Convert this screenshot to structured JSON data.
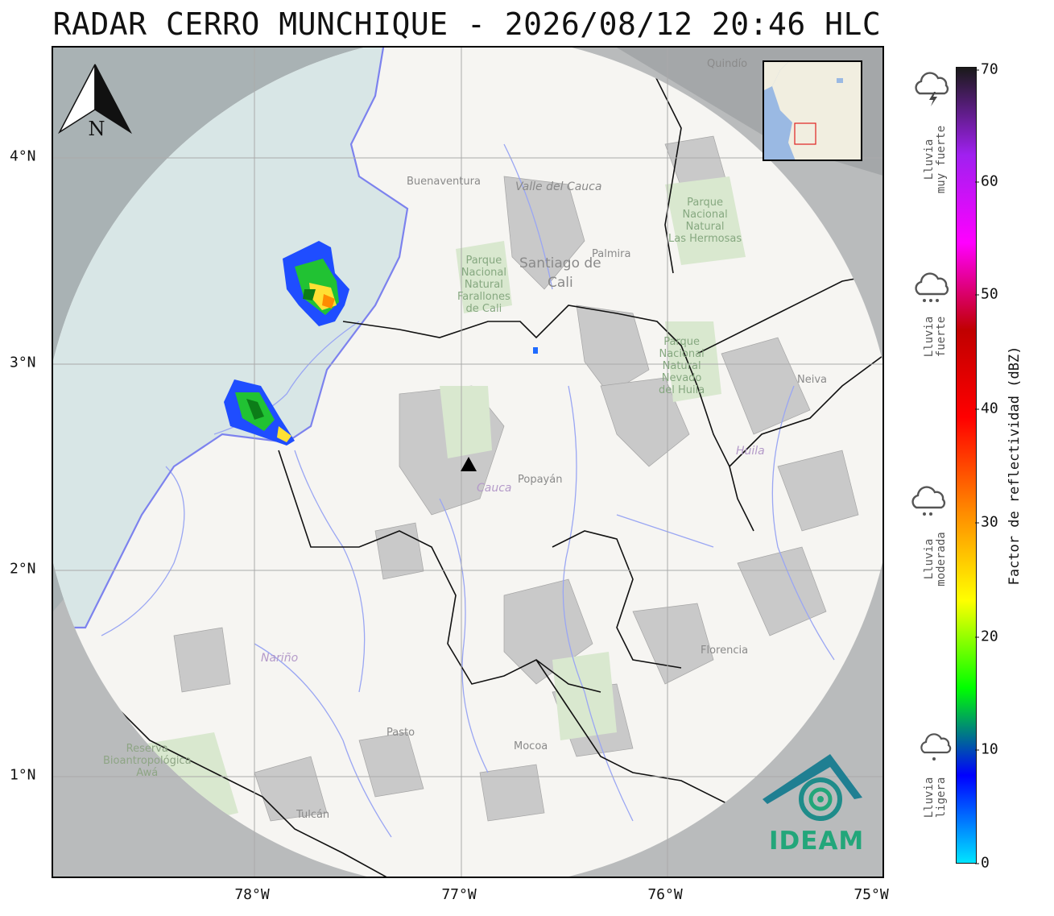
{
  "title": "RADAR CERRO MUNCHIQUE - 2026/08/12 20:46 HLC",
  "axes": {
    "x_ticks": [
      "78°W",
      "77°W",
      "76°W",
      "75°W"
    ],
    "y_ticks": [
      "4°N",
      "3°N",
      "2°N",
      "1°N"
    ]
  },
  "north_arrow": {
    "letter": "N",
    "icon": "north-arrow-icon"
  },
  "colorbar": {
    "label": "Factor de reflectividad (dBZ)",
    "ticks": [
      "70",
      "60",
      "50",
      "40",
      "30",
      "20",
      "10",
      "0"
    ],
    "range": [
      0,
      70
    ],
    "colors": [
      "#00e5ff",
      "#0000ff",
      "#00ff00",
      "#ffff00",
      "#ff8c00",
      "#ff0000",
      "#c00000",
      "#ff00ff",
      "#a020f0",
      "#1a1a1a"
    ]
  },
  "categories": [
    {
      "line1": "Lluvia",
      "line2": "muy fuerte",
      "icon": "thunderstorm-icon"
    },
    {
      "line1": "Lluvia",
      "line2": "fuerte",
      "icon": "heavy-rain-icon"
    },
    {
      "line1": "Lluvia",
      "line2": "moderada",
      "icon": "moderate-rain-icon"
    },
    {
      "line1": "Lluvia",
      "line2": "ligera",
      "icon": "light-rain-icon"
    }
  ],
  "map_labels": {
    "buenaventura": "Buenaventura",
    "valle": "Valle del Cauca",
    "quindio": "Quindío",
    "palmira": "Palmira",
    "cali1": "Santiago de",
    "cali2": "Cali",
    "farallones": [
      "Parque",
      "Nacional",
      "Natural",
      "Farallones",
      "de Cali"
    ],
    "hermosas": [
      "Parque",
      "Nacional",
      "Natural",
      "Las Hermosas"
    ],
    "pnn_huila": [
      "Parque",
      "Nacional",
      "Natural",
      "Nevado",
      "del Huila"
    ],
    "neiva": "Neiva",
    "huila": "Huila",
    "cauca": "Cauca",
    "popayan": "Popayán",
    "narino": "Nariño",
    "florencia": "Florencia",
    "pasto": "Pasto",
    "mocoa": "Mocoa",
    "tulcan": "Tulcán",
    "awa": [
      "Reserva",
      "Bioantropológica",
      "Awá"
    ]
  },
  "logo": {
    "text": "IDEAM",
    "color": "#23a67a"
  },
  "radar_marker": {
    "icon": "radar-site-triangle-icon"
  }
}
